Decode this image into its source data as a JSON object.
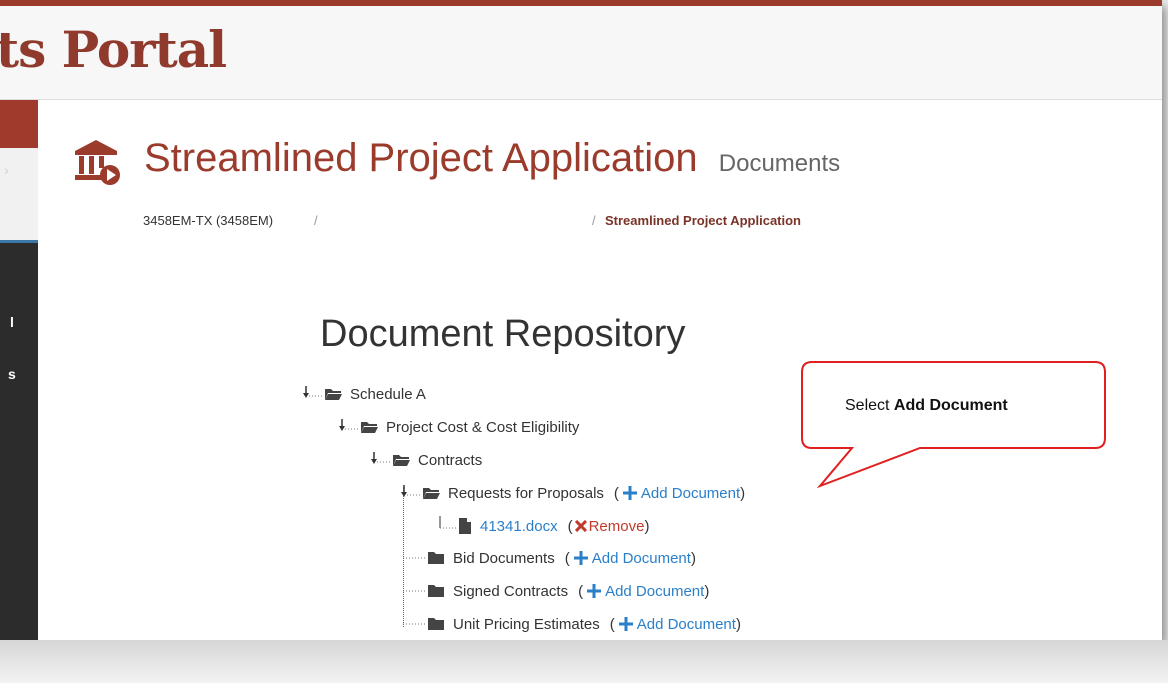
{
  "header": {
    "brand_fragment": "ts Portal"
  },
  "sidebar": {
    "text_1": "l",
    "text_2": "s"
  },
  "page": {
    "title": "Streamlined Project Application",
    "subtitle": "Documents"
  },
  "breadcrumb": {
    "item_1": "3458EM-TX (3458EM)",
    "sep": "/",
    "active": "Streamlined Project Application"
  },
  "repository": {
    "title": "Document Repository",
    "nodes": [
      {
        "label": "Schedule A"
      },
      {
        "label": "Project Cost & Cost Eligibility"
      },
      {
        "label": "Contracts"
      },
      {
        "label": "Requests for Proposals",
        "action": "Add Document"
      },
      {
        "label": "41341.docx",
        "action": "Remove"
      },
      {
        "label": "Bid Documents",
        "action": "Add Document"
      },
      {
        "label": "Signed Contracts",
        "action": "Add Document"
      },
      {
        "label": "Unit Pricing Estimates",
        "action": "Add Document"
      }
    ]
  },
  "callout": {
    "prefix": "Select ",
    "emphasis": "Add Document"
  },
  "icons": {
    "title": "bank-icon",
    "folder_open": "folder-open-icon",
    "folder": "folder-icon",
    "file": "file-icon",
    "plus": "plus-icon",
    "remove": "x-icon"
  },
  "colors": {
    "brand": "#9a3b2c",
    "link": "#2a7fc9",
    "remove": "#c0392b",
    "callout_border": "#e02020"
  }
}
